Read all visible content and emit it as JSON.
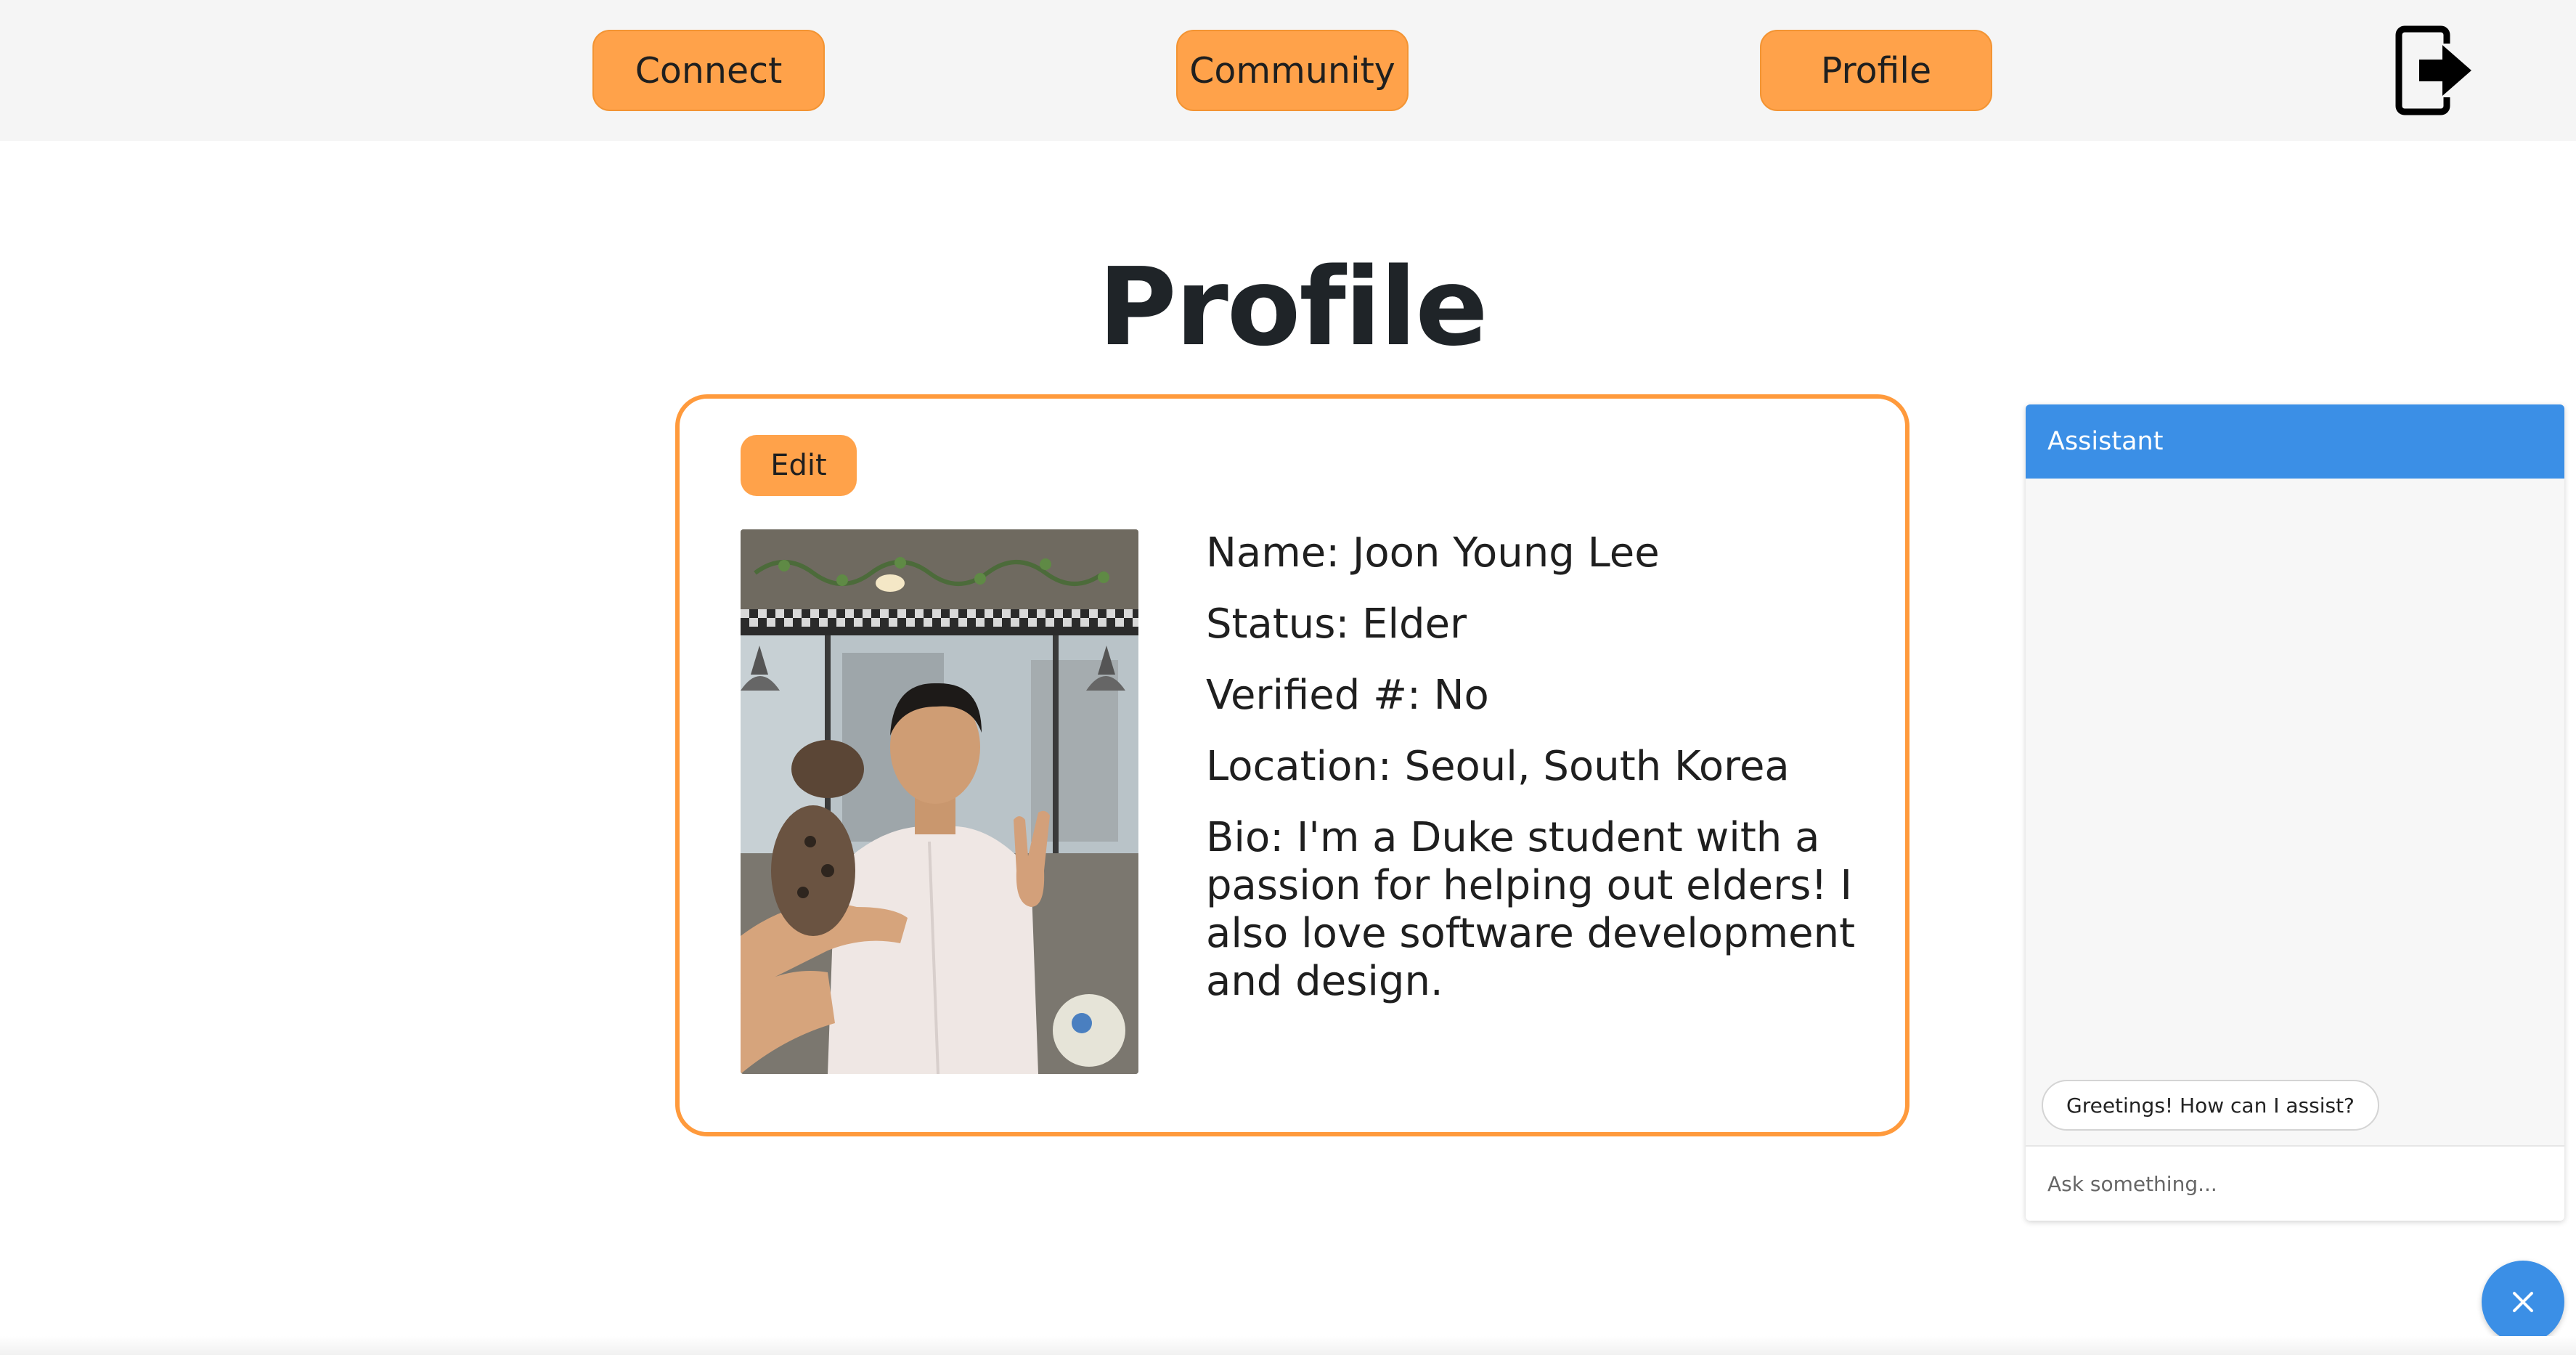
{
  "nav": {
    "connect_label": "Connect",
    "community_label": "Community",
    "profile_label": "Profile",
    "logout_icon": "logout-icon"
  },
  "page": {
    "title": "Profile"
  },
  "profile": {
    "edit_label": "Edit",
    "photo_icon": "profile-photo",
    "name_line": "Name: Joon Young Lee",
    "status_line": "Status: Elder",
    "verified_line": "Verified #: No",
    "location_line": "Location: Seoul, South Korea",
    "bio_line": "Bio: I'm a Duke student with a passion for helping out elders! I also love software development and design."
  },
  "assistant": {
    "title": "Assistant",
    "greeting": "Greetings! How can I assist?",
    "input_placeholder": "Ask something...",
    "input_value": ""
  },
  "fab": {
    "icon": "close-icon"
  },
  "colors": {
    "accent_orange": "#ffa24a",
    "card_border": "#ff9a3c",
    "assistant_blue": "#3b8fe6",
    "nav_background": "#f5f5f5",
    "text_dark": "#1f2428"
  }
}
